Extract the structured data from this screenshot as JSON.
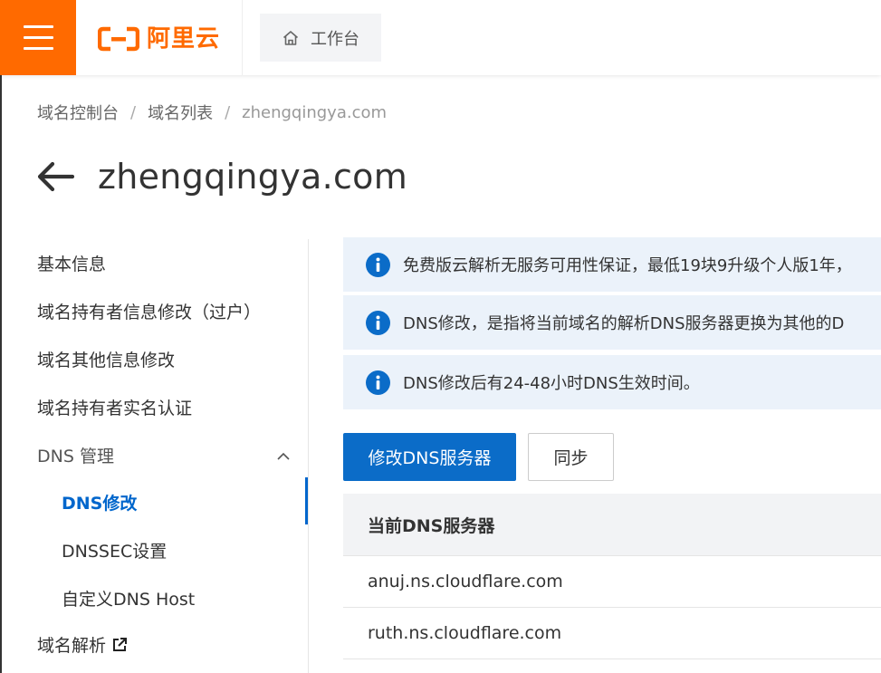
{
  "header": {
    "logo_text": "阿里云",
    "workbench_label": "工作台",
    "brand_color": "#ff6a00"
  },
  "breadcrumb": {
    "items": [
      "域名控制台",
      "域名列表",
      "zhengqingya.com"
    ],
    "separator": "/"
  },
  "page": {
    "title": "zhengqingya.com"
  },
  "sidebar": {
    "items": [
      {
        "label": "基本信息"
      },
      {
        "label": "域名持有者信息修改（过户）"
      },
      {
        "label": "域名其他信息修改"
      },
      {
        "label": "域名持有者实名认证"
      },
      {
        "label": "DNS 管理"
      },
      {
        "label": "DNS修改"
      },
      {
        "label": "DNSSEC设置"
      },
      {
        "label": "自定义DNS Host"
      },
      {
        "label": "域名解析"
      }
    ],
    "active_color": "#0066cc"
  },
  "notices": [
    {
      "text": "免费版云解析无服务可用性保证，最低19块9升级个人版1年，"
    },
    {
      "text": "DNS修改，是指将当前域名的解析DNS服务器更换为其他的D"
    },
    {
      "text": "DNS修改后有24-48小时DNS生效时间。"
    }
  ],
  "actions": {
    "modify_label": "修改DNS服务器",
    "sync_label": "同步"
  },
  "dns_table": {
    "header": "当前DNS服务器",
    "rows": [
      "anuj.ns.cloudflare.com",
      "ruth.ns.cloudflare.com"
    ]
  }
}
